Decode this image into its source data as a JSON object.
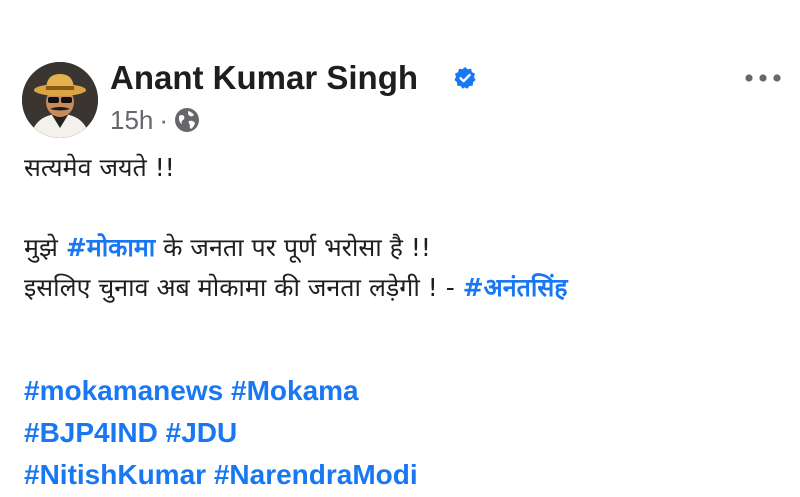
{
  "author": {
    "name": "Anant Kumar Singh",
    "verified_icon": "verified-badge-icon",
    "avatar": "avatar"
  },
  "meta": {
    "time": "15h",
    "separator": "·",
    "audience_icon": "globe-icon"
  },
  "menu": {
    "icon": "more-options-icon"
  },
  "post": {
    "line1": "सत्यमेव जयते !!",
    "line2": {
      "prefix": "मुझे ",
      "tag": "#मोकामा",
      "suffix": " के जनता पर पूर्ण भरोसा है !!"
    },
    "line3": {
      "prefix": "इसलिए चुनाव अब मोकामा की जनता लड़ेगी ! - ",
      "tag": "#अनंतसिंह"
    }
  },
  "hashtags": {
    "row1": [
      "#mokamanews",
      "#Mokama"
    ],
    "row2": [
      "#BJP4IND",
      "#JDU"
    ],
    "row3": [
      "#NitishKumar",
      "#NarendraModi"
    ]
  },
  "colors": {
    "link": "#1877f2",
    "text": "#1c1e21",
    "muted": "#65676b"
  }
}
